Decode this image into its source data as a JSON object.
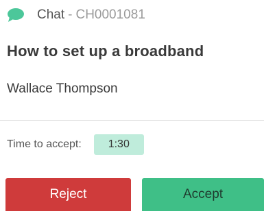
{
  "header": {
    "icon": "chat-bubble-icon",
    "title": "Chat",
    "separator": "-",
    "id": "CH0001081"
  },
  "subject": "How to set up a broadband",
  "customer_name": "Wallace Thompson",
  "timer": {
    "label": "Time to accept:",
    "value": "1:30"
  },
  "actions": {
    "reject_label": "Reject",
    "accept_label": "Accept"
  },
  "colors": {
    "chat_icon": "#4cc79a",
    "reject": "#cf3b3b",
    "accept": "#3fbf87",
    "timer_badge": "#bfecdb"
  }
}
